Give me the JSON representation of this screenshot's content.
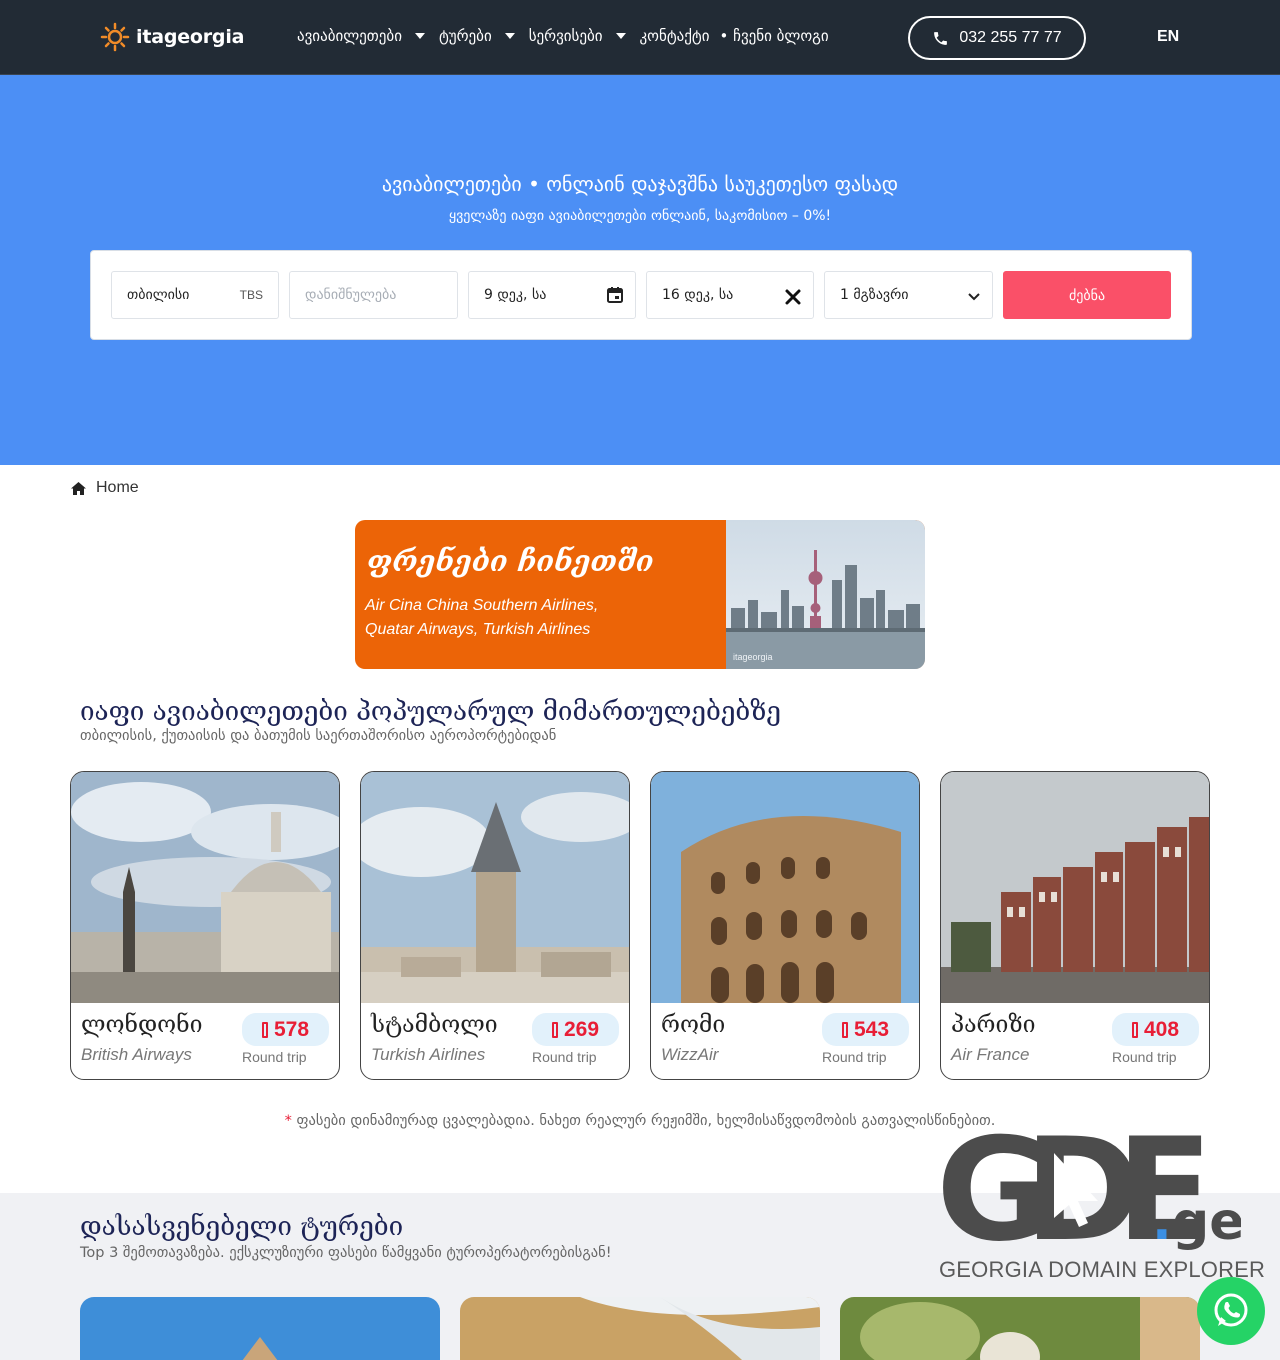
{
  "header": {
    "logo_text": "itageorgia",
    "nav": [
      {
        "label": "ავიაბილეთები",
        "has_dropdown": true
      },
      {
        "label": "ტურები",
        "has_dropdown": true
      },
      {
        "label": "სერვისები",
        "has_dropdown": true
      },
      {
        "label": "კონტაქტი",
        "has_dropdown": false
      },
      {
        "label": "• ჩვენი ბლოგი",
        "has_dropdown": false
      }
    ],
    "phone": "032 255 77 77",
    "language": "EN"
  },
  "hero": {
    "title": "ავიაბილეთები • ონლაინ დაჯავშნა საუკეთესო ფასად",
    "subtitle": "ყველაზე იაფი ავიაბილეთები ონლაინ,  საკომისიო – 0%!",
    "background_color": "#4c8ff5"
  },
  "search": {
    "from_value": "თბილისი",
    "from_code": "TBS",
    "to_placeholder": "დანიშნულება",
    "depart_date": "9 დეკ, სა",
    "return_date": "16 დეკ, სა",
    "passengers": "1 მგზავრი",
    "button_label": "ძებნა",
    "button_color": "#fa5068"
  },
  "breadcrumb": {
    "home_label": "Home"
  },
  "promo": {
    "title": "ფრენები ჩინეთში",
    "text_line1": "Air Cina China Southern Airlines,",
    "text_line2": "Quatar Airways, Turkish Airlines",
    "image_watermark": "itageorgia",
    "background_color": "#ec6407"
  },
  "cheap_flights": {
    "title": "იაფი ავიაბილეთები პოპულარულ მიმართულებებზე",
    "subtitle": "თბილისის, ქუთაისის და ბათუმის საერთაშორისო აეროპორტებიდან",
    "cards": [
      {
        "city": "ლონდონი",
        "airline": "British Airways",
        "price": "578",
        "trip": "Round trip"
      },
      {
        "city": "სტამბოლი",
        "airline": "Turkish Airlines",
        "price": "269",
        "trip": "Round trip"
      },
      {
        "city": "რომი",
        "airline": "WizzAir",
        "price": "543",
        "trip": "Round trip"
      },
      {
        "city": "პარიზი",
        "airline": "Air France",
        "price": "408",
        "trip": "Round trip"
      }
    ],
    "note_star": "*",
    "note": "ფასები დინამიურად ცვალებადია. ნახეთ რეალურ რეჟიმში,  ხელმისაწვდომობის გათვალისწინებით."
  },
  "tours": {
    "title": "დასასვენებელი ტურები",
    "subtitle": "Top 3 შემოთავაზება. ექსკლუზიური ფასები წამყვანი ტუროპერატორებისგან!"
  },
  "watermark": {
    "brand_g": "G",
    "brand_d": "D",
    "brand_e": "E",
    "brand_dot": ".",
    "brand_ge": "ge",
    "tagline": "GEORGIA DOMAIN EXPLORER"
  }
}
